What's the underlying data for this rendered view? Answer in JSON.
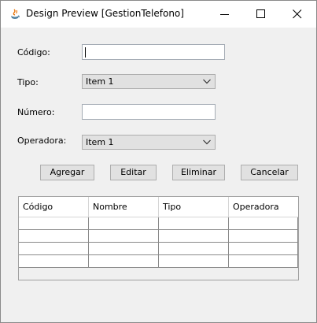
{
  "window": {
    "title": "Design Preview [GestionTelefono]"
  },
  "form": {
    "codigo_label": "Código:",
    "codigo_value": "",
    "tipo_label": "Tipo:",
    "tipo_selected": "Item 1",
    "numero_label": "Número:",
    "numero_value": "",
    "operadora_label": "Operadora:",
    "operadora_selected": "Item 1"
  },
  "buttons": {
    "agregar": "Agregar",
    "editar": "Editar",
    "eliminar": "Eliminar",
    "cancelar": "Cancelar"
  },
  "table": {
    "columns": [
      "Código",
      "Nombre",
      "Tipo",
      "Operadora"
    ],
    "rows": [
      [
        "",
        "",
        "",
        ""
      ],
      [
        "",
        "",
        "",
        ""
      ],
      [
        "",
        "",
        "",
        ""
      ],
      [
        "",
        "",
        "",
        ""
      ]
    ]
  },
  "colors": {
    "window_bg": "#f0f0f0",
    "titlebar_bg": "#ffffff",
    "button_bg": "#e1e1e1"
  }
}
